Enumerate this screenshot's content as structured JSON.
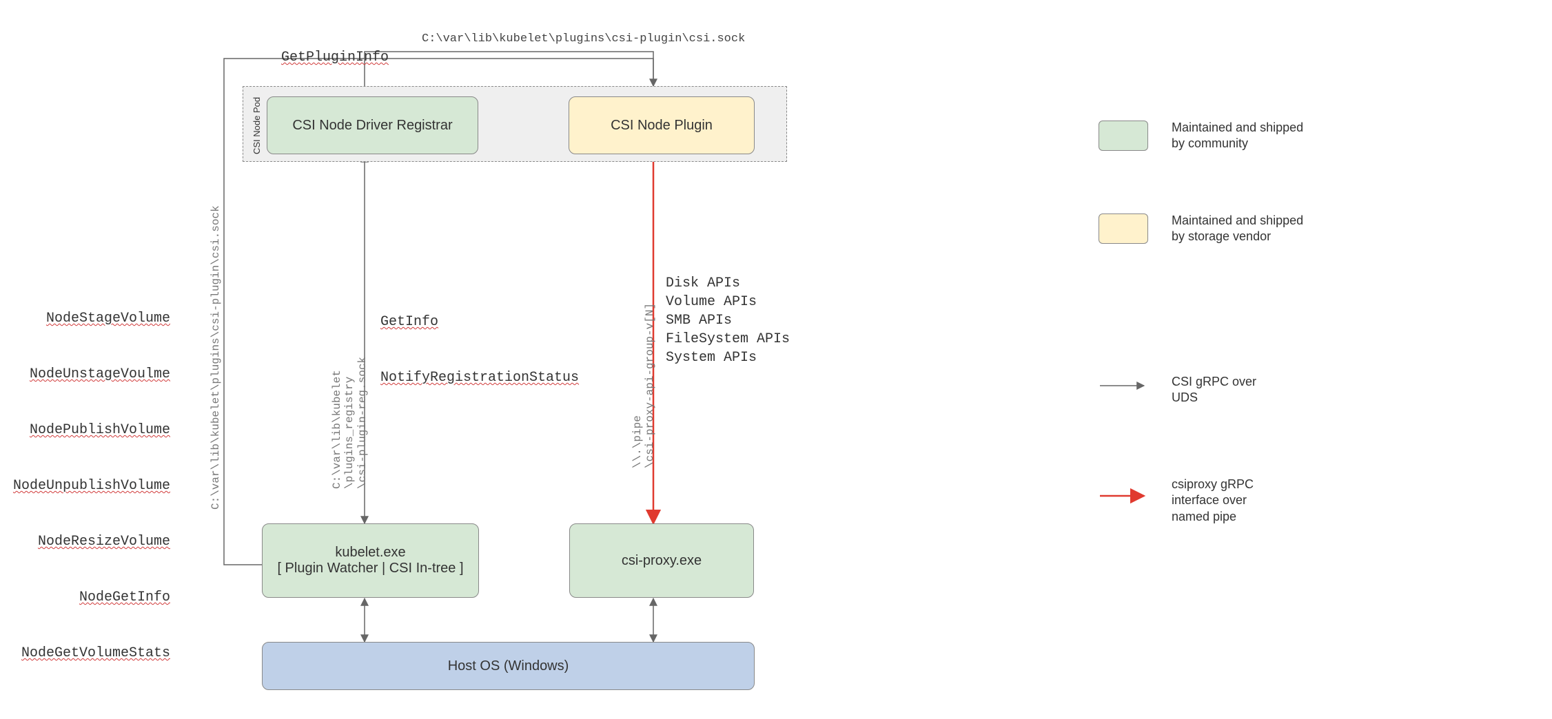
{
  "top_labels": {
    "get_plugin_info": "GetPluginInfo",
    "sock_path": "C:\\var\\lib\\kubelet\\plugins\\csi-plugin\\csi.sock"
  },
  "pod": {
    "label": "CSI Node Pod",
    "registrar": "CSI Node Driver Registrar",
    "plugin": "CSI Node Plugin"
  },
  "left_api_list": {
    "line1": "NodeStageVolume",
    "line2": "NodeUnstageVoulme",
    "line3": "NodePublishVolume",
    "line4": "NodeUnpublishVolume",
    "line5": "NodeResizeVolume",
    "line6": "NodeGetInfo",
    "line7": "NodeGetVolumeStats"
  },
  "left_vertical_path": "C:\\var\\lib\\kubelet\\plugins\\csi-plugin\\csi.sock",
  "mid": {
    "reg_path": "C:\\var\\lib\\kubelet\n\\plugins_registry\n\\csi-plugin-reg.sock",
    "getinfo": "GetInfo",
    "notify": "NotifyRegistrationStatus"
  },
  "right": {
    "pipe_path": "\\\\.\\pipe\n\\csi-proxy-api-group-v[N]",
    "apis": "Disk APIs\nVolume APIs\nSMB APIs\nFileSystem APIs\nSystem APIs"
  },
  "bottom": {
    "kubelet_line1": "kubelet.exe",
    "kubelet_line2": "[ Plugin Watcher | CSI In-tree ]",
    "csiproxy": "csi-proxy.exe",
    "hostos": "Host OS (Windows)"
  },
  "legend": {
    "community": "Maintained and shipped\nby community",
    "vendor": "Maintained and shipped\nby storage vendor",
    "csi_grpc": "CSI gRPC over\nUDS",
    "csiproxy_grpc": "csiproxy gRPC\ninterface over\nnamed pipe"
  },
  "colors": {
    "green": "#d6e8d5",
    "yellow": "#fff2cc",
    "blue": "#bfd0e8",
    "red": "#e03a2f",
    "gray": "#666666"
  }
}
